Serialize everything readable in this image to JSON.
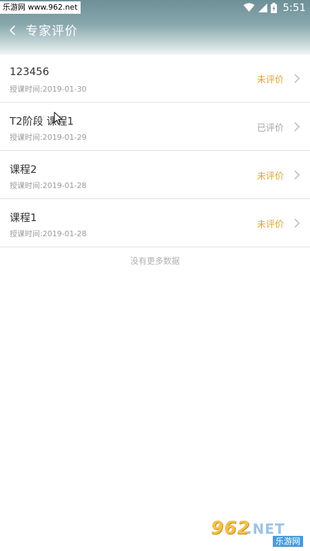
{
  "status_bar": {
    "watermark_text": "乐游网 www.962.net",
    "time": "5:51",
    "icons": [
      "wifi-icon",
      "signal-icon",
      "battery-icon"
    ]
  },
  "nav": {
    "back_icon": "chevron-left-icon",
    "title": "专家评价"
  },
  "colors": {
    "header_gradient_top": "#6d8f96",
    "pending_status": "#e0a23a",
    "done_status": "#a6a6a6"
  },
  "courses": [
    {
      "title": "123456",
      "time": "授课时间:2019-01-30",
      "status": "未评价",
      "evaluated": false
    },
    {
      "title": "T2阶段 课程1",
      "time": "授课时间:2019-01-29",
      "status": "已评价",
      "evaluated": true
    },
    {
      "title": "课程2",
      "time": "授课时间:2019-01-28",
      "status": "未评价",
      "evaluated": false
    },
    {
      "title": "课程1",
      "time": "授课时间:2019-01-28",
      "status": "未评价",
      "evaluated": false
    }
  ],
  "list_footer": "没有更多数据",
  "watermark": {
    "logo": "962",
    "suffix": ".NET",
    "name": "乐游网"
  }
}
